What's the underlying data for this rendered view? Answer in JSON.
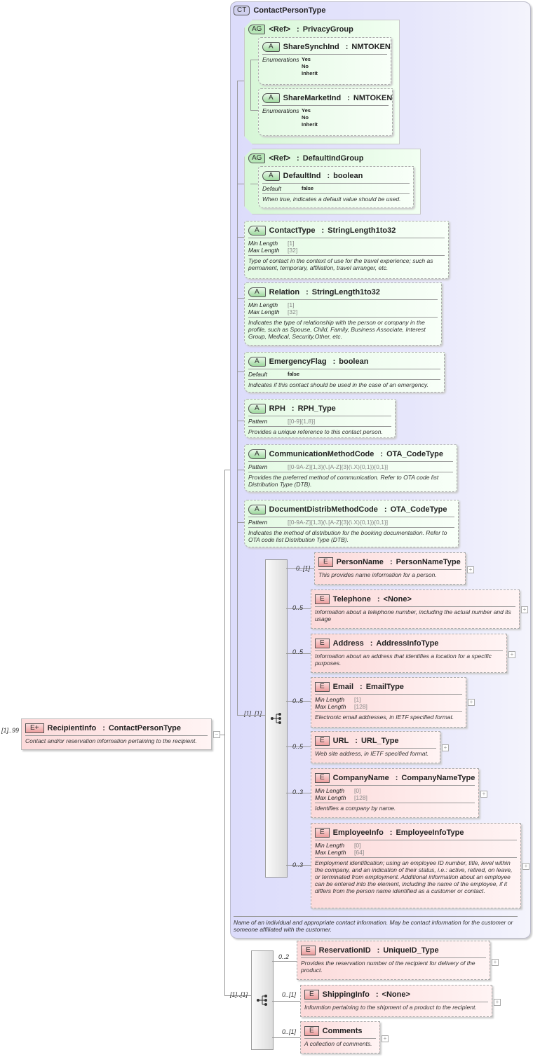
{
  "separator": ":",
  "root": {
    "occurs": "[1]..99",
    "badge": "E+",
    "name": "RecipientInfo",
    "type": "ContactPersonType",
    "desc": "Contact and/or reservation information pertaining to the recipient.",
    "collapse": "−"
  },
  "complex_type": {
    "badge": "CT",
    "name": "ContactPersonType",
    "desc": "Name of an individual and appropriate contact information.  May be contact information for the customer or someone affiliated with the customer."
  },
  "attribute_groups": [
    {
      "badge": "AG",
      "name": "<Ref>",
      "type": "PrivacyGroup",
      "attributes": [
        {
          "badge": "A",
          "name": "ShareSynchInd",
          "type": "NMTOKEN",
          "facets": [
            {
              "label": "Enumerations",
              "value": "Yes\nNo\nInherit",
              "style": "enum"
            }
          ]
        },
        {
          "badge": "A",
          "name": "ShareMarketInd",
          "type": "NMTOKEN",
          "facets": [
            {
              "label": "Enumerations",
              "value": "Yes\nNo\nInherit",
              "style": "enum"
            }
          ]
        }
      ]
    },
    {
      "badge": "AG",
      "name": "<Ref>",
      "type": "DefaultIndGroup",
      "attributes": [
        {
          "badge": "A",
          "name": "DefaultInd",
          "type": "boolean",
          "facets": [
            {
              "label": "Default",
              "value": "false",
              "style": "bold"
            }
          ],
          "desc": "When true, indicates a default value should be used."
        }
      ]
    }
  ],
  "attributes": [
    {
      "badge": "A",
      "name": "ContactType",
      "type": "StringLength1to32",
      "facets": [
        {
          "label": "Min Length",
          "value": "[1]"
        },
        {
          "label": "Max Length",
          "value": "[32]"
        }
      ],
      "desc": "Type of contact in the context of use for the travel experience; such as permanent, temporary, affiliation, travel arranger, etc."
    },
    {
      "badge": "A",
      "name": "Relation",
      "type": "StringLength1to32",
      "facets": [
        {
          "label": "Min Length",
          "value": "[1]"
        },
        {
          "label": "Max Length",
          "value": "[32]"
        }
      ],
      "desc": "Indicates the type of relationship with the person or company in the profile, such as Spouse, Child, Family, Business Associate, Interest Group, Medical, Security,Other, etc."
    },
    {
      "badge": "A",
      "name": "EmergencyFlag",
      "type": "boolean",
      "facets": [
        {
          "label": "Default",
          "value": "false",
          "style": "bold"
        }
      ],
      "desc": "Indicates if this contact should be used in the case of an emergency."
    },
    {
      "badge": "A",
      "name": "RPH",
      "type": "RPH_Type",
      "facets": [
        {
          "label": "Pattern",
          "value": "[[0-9]{1,8}]"
        }
      ],
      "desc": "Provides a unique reference to this contact person."
    },
    {
      "badge": "A",
      "name": "CommunicationMethodCode",
      "type": "OTA_CodeType",
      "facets": [
        {
          "label": "Pattern",
          "value": "[[0-9A-Z]{1,3}(\\.[A-Z]{3}(\\.X){0,1}){0,1}]"
        }
      ],
      "desc": "Provides the preferred method of communication.  Refer to OTA code list Distribution Type (DTB)."
    },
    {
      "badge": "A",
      "name": "DocumentDistribMethodCode",
      "type": "OTA_CodeType",
      "facets": [
        {
          "label": "Pattern",
          "value": "[[0-9A-Z]{1,3}(\\.[A-Z]{3}(\\.X){0,1}){0,1}]"
        }
      ],
      "desc": "Indicates the method of distribution for the booking documentation.  Refer to OTA code list Distribution Type (DTB)."
    }
  ],
  "sequences": [
    {
      "occurs": "[1]..[1]",
      "elements": [
        {
          "occurs": "0..[1]",
          "badge": "E",
          "name": "PersonName",
          "type": "PersonNameType",
          "desc": "This provides name information for a person.",
          "expand": "+"
        },
        {
          "occurs": "0..5",
          "badge": "E",
          "name": "Telephone",
          "type": "<None>",
          "desc": "Information about a telephone number, including the actual number and its usage",
          "expand": "+"
        },
        {
          "occurs": "0..5",
          "badge": "E",
          "name": "Address",
          "type": "AddressInfoType",
          "desc": "Information about an address that identifies a location for a specific purposes.",
          "expand": "+"
        },
        {
          "occurs": "0..5",
          "badge": "E",
          "name": "Email",
          "type": "EmailType",
          "facets": [
            {
              "label": "Min Length",
              "value": "[1]"
            },
            {
              "label": "Max Length",
              "value": "[128]"
            }
          ],
          "desc": "Electronic email addresses, in IETF specified format.",
          "expand": "+"
        },
        {
          "occurs": "0..5",
          "badge": "E",
          "name": "URL",
          "type": "URL_Type",
          "desc": "Web site address, in IETF specified format.",
          "expand": "+"
        },
        {
          "occurs": "0..3",
          "badge": "E",
          "name": "CompanyName",
          "type": "CompanyNameType",
          "facets": [
            {
              "label": "Min Length",
              "value": "[0]"
            },
            {
              "label": "Max Length",
              "value": "[128]"
            }
          ],
          "desc": "Identifies a company by name.",
          "expand": "+"
        },
        {
          "occurs": "0..3",
          "badge": "E",
          "name": "EmployeeInfo",
          "type": "EmployeeInfoType",
          "facets": [
            {
              "label": "Min Length",
              "value": "[0]"
            },
            {
              "label": "Max Length",
              "value": "[64]"
            }
          ],
          "desc": "Employment identification; using an employee ID number, title, level within the company, and an indication of their status, i.e.: active, retired, on leave, or terminated from employment.  Additional information about an employee can be entered into the element, including the name of the employee, if it differs from the person name identified as a customer or contact.",
          "expand": "+"
        }
      ]
    },
    {
      "occurs": "[1]..[1]",
      "elements": [
        {
          "occurs": "0..2",
          "badge": "E",
          "name": "ReservationID",
          "type": "UniqueID_Type",
          "desc": "Provides the reservation number of the recipient for delivery of the product.",
          "expand": "+"
        },
        {
          "occurs": "0..[1]",
          "badge": "E",
          "name": "ShippingInfo",
          "type": "<None>",
          "desc": "Informtion pertaining to the shipment of a product to the recipient.",
          "expand": "+"
        },
        {
          "occurs": "0..[1]",
          "badge": "E",
          "name": "Comments",
          "desc": "A collection of comments.",
          "expand": "+"
        }
      ]
    }
  ]
}
